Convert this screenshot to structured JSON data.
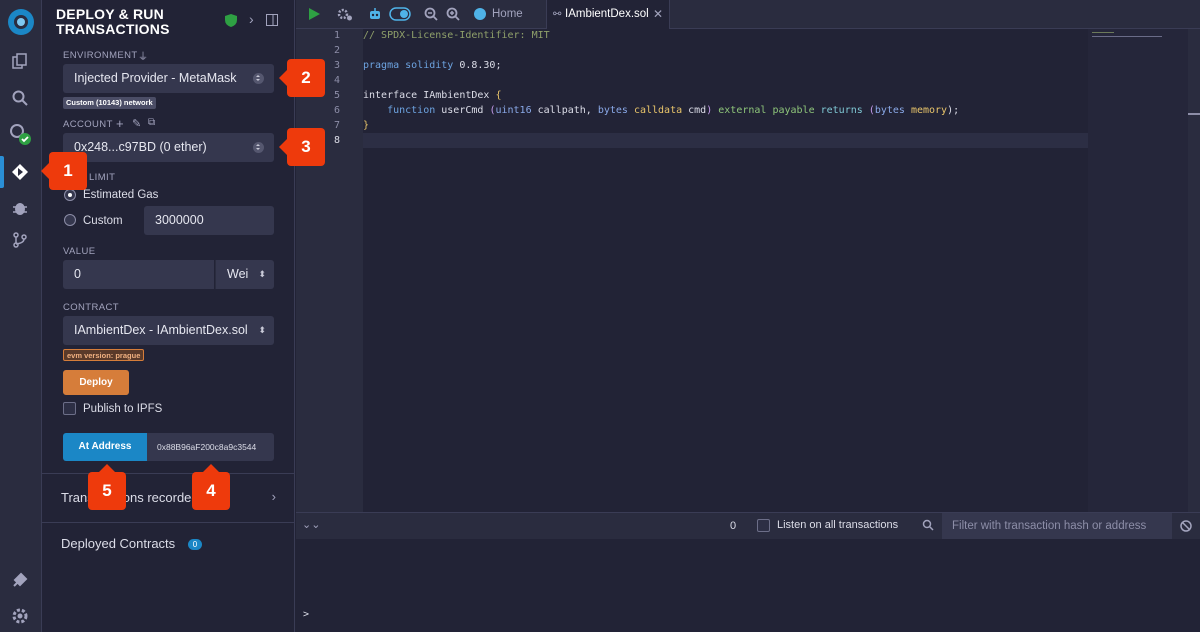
{
  "panel": {
    "title": "DEPLOY & RUN TRANSACTIONS",
    "environment_label": "ENVIRONMENT",
    "environment_value": "Injected Provider - MetaMask",
    "network_badge": "Custom (10143) network",
    "account_label": "ACCOUNT",
    "account_value": "0x248...c97BD (0 ether)",
    "gas_limit_label": "LIMIT",
    "gas_estimated_label": "Estimated Gas",
    "gas_custom_label": "Custom",
    "gas_custom_value": "3000000",
    "value_label": "VALUE",
    "value_amount": "0",
    "value_unit": "Wei",
    "contract_label": "CONTRACT",
    "contract_value": "IAmbientDex - IAmbientDex.sol",
    "evm_badge": "evm version: prague",
    "deploy_button": "Deploy",
    "publish_ipfs_label": "Publish to IPFS",
    "at_address_button": "At Address",
    "at_address_value": "0x88B96aF200c8a9c3544",
    "transactions_recorded": "Trans",
    "transactions_recorded_tail": "ons recorded",
    "deployed_contracts": "Deployed Contracts",
    "deployed_count": "0"
  },
  "callouts": [
    "1",
    "2",
    "3",
    "4",
    "5"
  ],
  "toolbar": {
    "home_tab": "Home",
    "file_tab": "IAmbientDex.sol"
  },
  "editor": {
    "line_numbers": [
      "1",
      "2",
      "3",
      "4",
      "5",
      "6",
      "7",
      "8"
    ],
    "lines": {
      "l1": "// SPDX-License-Identifier: MIT",
      "l3_kw": "pragma solidity",
      "l3_ver": " 0.8.30;",
      "l5_kw": "interface",
      "l5_name": " IAmbientDex ",
      "l5_brace": "{",
      "l6_fn": "    function",
      "l6_name": " userCmd ",
      "l6_p1": "(",
      "l6_t1": "uint16",
      "l6_a1": " callpath, ",
      "l6_t2": "bytes",
      "l6_s1": " calldata",
      "l6_a2": " cmd",
      "l6_p2": ") ",
      "l6_ext": "external payable",
      "l6_ret": " returns ",
      "l6_p3": "(",
      "l6_t3": "bytes",
      "l6_mem": " memory",
      "l6_end": ");",
      "l7": "}"
    }
  },
  "terminal": {
    "count": "0",
    "listen_label": "Listen on all transactions",
    "filter_placeholder": "Filter with transaction hash or address",
    "prompt": ">"
  },
  "colors": {
    "accent_blue": "#1b87c6",
    "deploy_orange": "#d67d3a",
    "callout_red": "#ee3a0c"
  }
}
